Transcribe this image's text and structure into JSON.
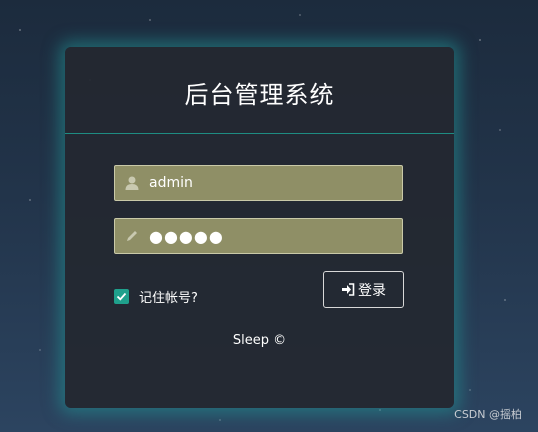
{
  "login": {
    "title": "后台管理系统",
    "username": {
      "value": "admin",
      "icon": "user-icon"
    },
    "password": {
      "value": "●●●●●",
      "icon": "pencil-icon"
    },
    "remember": {
      "label": "记住帐号?",
      "checked": true
    },
    "submit": {
      "label": "登录",
      "icon": "sign-in-icon"
    },
    "footer": "Sleep ©"
  },
  "watermark": "CSDN @摇柏",
  "colors": {
    "panel_bg": "#232830",
    "accent": "#1fa08c",
    "input_bg": "#8f8f66"
  }
}
